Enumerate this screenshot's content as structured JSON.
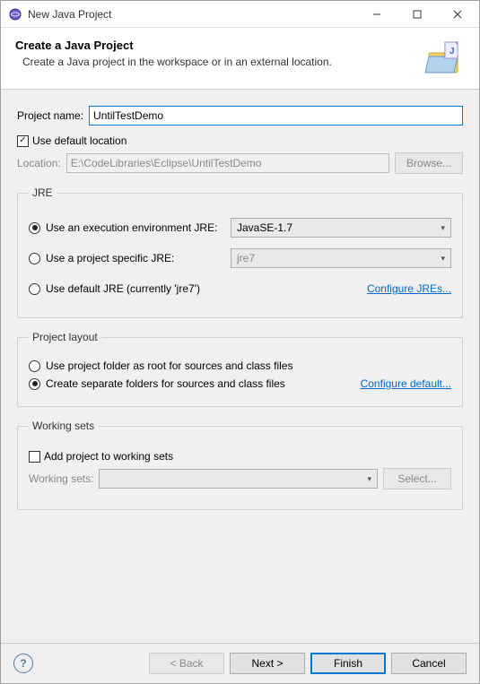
{
  "window": {
    "title": "New Java Project"
  },
  "banner": {
    "title": "Create a Java Project",
    "description": "Create a Java project in the workspace or in an external location."
  },
  "projectName": {
    "label": "Project name:",
    "value": "UntilTestDemo"
  },
  "defaultLocation": {
    "checkbox": "Use default location",
    "checked": true,
    "locationLabel": "Location:",
    "locationValue": "E:\\CodeLibraries\\Eclipse\\UntilTestDemo",
    "browse": "Browse..."
  },
  "jre": {
    "legend": "JRE",
    "opt1": "Use an execution environment JRE:",
    "opt1_value": "JavaSE-1.7",
    "opt2": "Use a project specific JRE:",
    "opt2_value": "jre7",
    "opt3": "Use default JRE (currently 'jre7')",
    "configure": "Configure JREs..."
  },
  "layout": {
    "legend": "Project layout",
    "opt1": "Use project folder as root for sources and class files",
    "opt2": "Create separate folders for sources and class files",
    "configure": "Configure default..."
  },
  "workingSets": {
    "legend": "Working sets",
    "checkbox": "Add project to working sets",
    "label": "Working sets:",
    "select": "Select..."
  },
  "buttons": {
    "back": "< Back",
    "next": "Next >",
    "finish": "Finish",
    "cancel": "Cancel"
  }
}
